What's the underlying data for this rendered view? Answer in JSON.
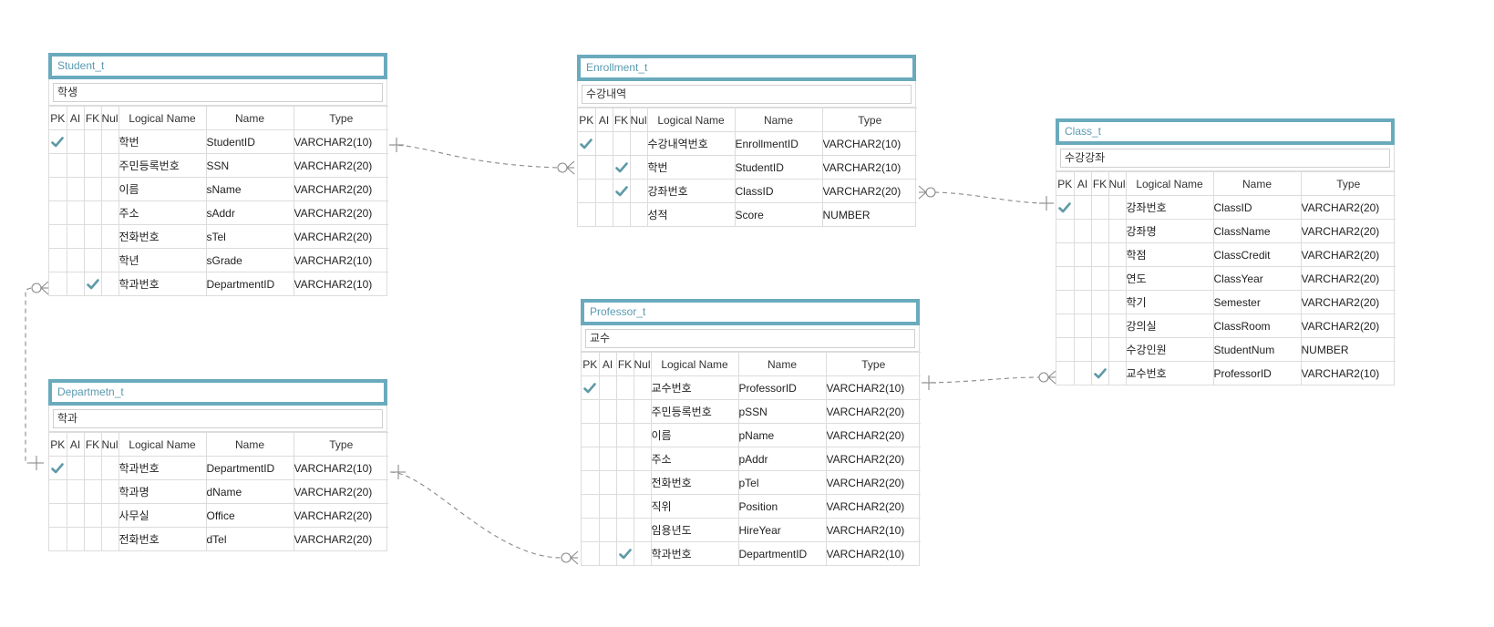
{
  "headers": {
    "pk": "PK",
    "ai": "AI",
    "fk": "FK",
    "null": "Null",
    "logical": "Logical Name",
    "name": "Name",
    "type": "Type"
  },
  "colors": {
    "title_border": "#6aaabd",
    "title_text": "#5a9ab0",
    "check": "#5e9aa8",
    "grid": "#dcdcdc",
    "link": "#8a8a8a"
  },
  "icons": {
    "check": "check-icon",
    "one": "one-marker-icon",
    "zero_many": "zero-or-many-marker-icon"
  },
  "entities": {
    "student": {
      "title": "Student_t",
      "comment": "학생",
      "columns": [
        {
          "pk": true,
          "fk": false,
          "logical": "학번",
          "name": "StudentID",
          "type": "VARCHAR2(10)"
        },
        {
          "pk": false,
          "fk": false,
          "logical": "주민등록번호",
          "name": "SSN",
          "type": "VARCHAR2(20)"
        },
        {
          "pk": false,
          "fk": false,
          "logical": "이름",
          "name": "sName",
          "type": "VARCHAR2(20)"
        },
        {
          "pk": false,
          "fk": false,
          "logical": "주소",
          "name": "sAddr",
          "type": "VARCHAR2(20)"
        },
        {
          "pk": false,
          "fk": false,
          "logical": "전화번호",
          "name": "sTel",
          "type": "VARCHAR2(20)"
        },
        {
          "pk": false,
          "fk": false,
          "logical": "학년",
          "name": "sGrade",
          "type": "VARCHAR2(10)"
        },
        {
          "pk": false,
          "fk": true,
          "logical": "학과번호",
          "name": "DepartmentID",
          "type": "VARCHAR2(10)"
        }
      ]
    },
    "department": {
      "title": "Departmetn_t",
      "comment": "학과",
      "columns": [
        {
          "pk": true,
          "fk": false,
          "logical": "학과번호",
          "name": "DepartmentID",
          "type": "VARCHAR2(10)"
        },
        {
          "pk": false,
          "fk": false,
          "logical": "학과명",
          "name": "dName",
          "type": "VARCHAR2(20)"
        },
        {
          "pk": false,
          "fk": false,
          "logical": "사무실",
          "name": "Office",
          "type": "VARCHAR2(20)"
        },
        {
          "pk": false,
          "fk": false,
          "logical": "전화번호",
          "name": "dTel",
          "type": "VARCHAR2(20)"
        }
      ]
    },
    "enrollment": {
      "title": "Enrollment_t",
      "comment": "수강내역",
      "columns": [
        {
          "pk": true,
          "fk": false,
          "logical": "수강내역번호",
          "name": "EnrollmentID",
          "type": "VARCHAR2(10)"
        },
        {
          "pk": false,
          "fk": true,
          "logical": "학번",
          "name": "StudentID",
          "type": "VARCHAR2(10)"
        },
        {
          "pk": false,
          "fk": true,
          "logical": "강좌번호",
          "name": "ClassID",
          "type": "VARCHAR2(20)"
        },
        {
          "pk": false,
          "fk": false,
          "logical": "성적",
          "name": "Score",
          "type": "NUMBER"
        }
      ]
    },
    "professor": {
      "title": "Professor_t",
      "comment": "교수",
      "columns": [
        {
          "pk": true,
          "fk": false,
          "logical": "교수번호",
          "name": "ProfessorID",
          "type": "VARCHAR2(10)"
        },
        {
          "pk": false,
          "fk": false,
          "logical": "주민등록번호",
          "name": "pSSN",
          "type": "VARCHAR2(20)"
        },
        {
          "pk": false,
          "fk": false,
          "logical": "이름",
          "name": "pName",
          "type": "VARCHAR2(20)"
        },
        {
          "pk": false,
          "fk": false,
          "logical": "주소",
          "name": "pAddr",
          "type": "VARCHAR2(20)"
        },
        {
          "pk": false,
          "fk": false,
          "logical": "전화번호",
          "name": "pTel",
          "type": "VARCHAR2(20)"
        },
        {
          "pk": false,
          "fk": false,
          "logical": "직위",
          "name": "Position",
          "type": "VARCHAR2(20)"
        },
        {
          "pk": false,
          "fk": false,
          "logical": "임용년도",
          "name": "HireYear",
          "type": "VARCHAR2(10)"
        },
        {
          "pk": false,
          "fk": true,
          "logical": "학과번호",
          "name": "DepartmentID",
          "type": "VARCHAR2(10)"
        }
      ]
    },
    "class": {
      "title": "Class_t",
      "comment": "수강강좌",
      "columns": [
        {
          "pk": true,
          "fk": false,
          "logical": "강좌번호",
          "name": "ClassID",
          "type": "VARCHAR2(20)"
        },
        {
          "pk": false,
          "fk": false,
          "logical": "강좌명",
          "name": "ClassName",
          "type": "VARCHAR2(20)"
        },
        {
          "pk": false,
          "fk": false,
          "logical": "학점",
          "name": "ClassCredit",
          "type": "VARCHAR2(20)"
        },
        {
          "pk": false,
          "fk": false,
          "logical": "연도",
          "name": "ClassYear",
          "type": "VARCHAR2(20)"
        },
        {
          "pk": false,
          "fk": false,
          "logical": "학기",
          "name": "Semester",
          "type": "VARCHAR2(20)"
        },
        {
          "pk": false,
          "fk": false,
          "logical": "강의실",
          "name": "ClassRoom",
          "type": "VARCHAR2(20)"
        },
        {
          "pk": false,
          "fk": false,
          "logical": "수강인원",
          "name": "StudentNum",
          "type": "NUMBER"
        },
        {
          "pk": false,
          "fk": true,
          "logical": "교수번호",
          "name": "ProfessorID",
          "type": "VARCHAR2(10)"
        }
      ]
    }
  },
  "relations": [
    {
      "from": "student",
      "to": "enrollment",
      "from_card": "one",
      "to_card": "zero-or-many"
    },
    {
      "from": "class",
      "to": "enrollment",
      "from_card": "one",
      "to_card": "zero-or-many"
    },
    {
      "from": "department",
      "to": "student",
      "from_card": "one",
      "to_card": "zero-or-many"
    },
    {
      "from": "department",
      "to": "professor",
      "from_card": "one",
      "to_card": "zero-or-many"
    },
    {
      "from": "professor",
      "to": "class",
      "from_card": "one",
      "to_card": "zero-or-many"
    }
  ]
}
